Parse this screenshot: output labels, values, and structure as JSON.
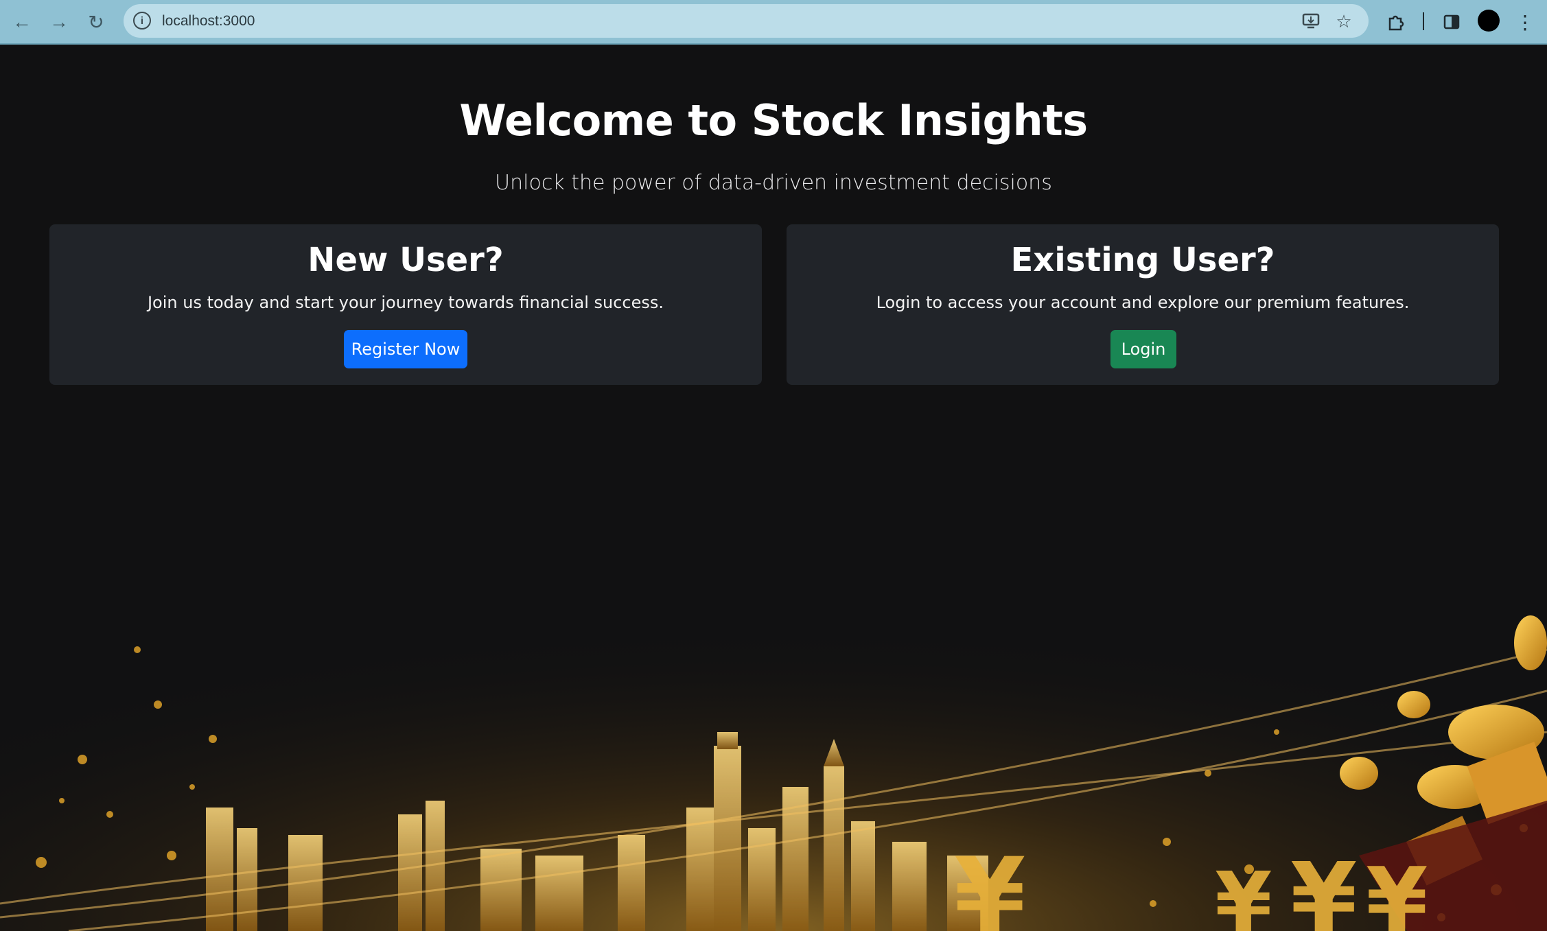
{
  "browser": {
    "url": "localhost:3000",
    "icons": [
      "back-icon",
      "forward-icon",
      "reload-icon",
      "site-info-icon",
      "install-app-icon",
      "bookmark-star-icon",
      "extensions-icon",
      "side-panel-icon",
      "profile-avatar",
      "menu-kebab-icon"
    ]
  },
  "hero": {
    "title": "Welcome to Stock Insights",
    "subtitle": "Unlock the power of data-driven investment decisions"
  },
  "cards": {
    "new_user": {
      "heading": "New User?",
      "text": "Join us today and start your journey towards financial success.",
      "button": "Register Now",
      "button_color": "#0d6efd"
    },
    "existing_user": {
      "heading": "Existing User?",
      "text": "Login to access your account and explore our premium features.",
      "button": "Login",
      "button_color": "#198754"
    }
  },
  "colors": {
    "page_background": "#111112",
    "card_background": "#212429",
    "accent_gold": "#d9a21c"
  }
}
